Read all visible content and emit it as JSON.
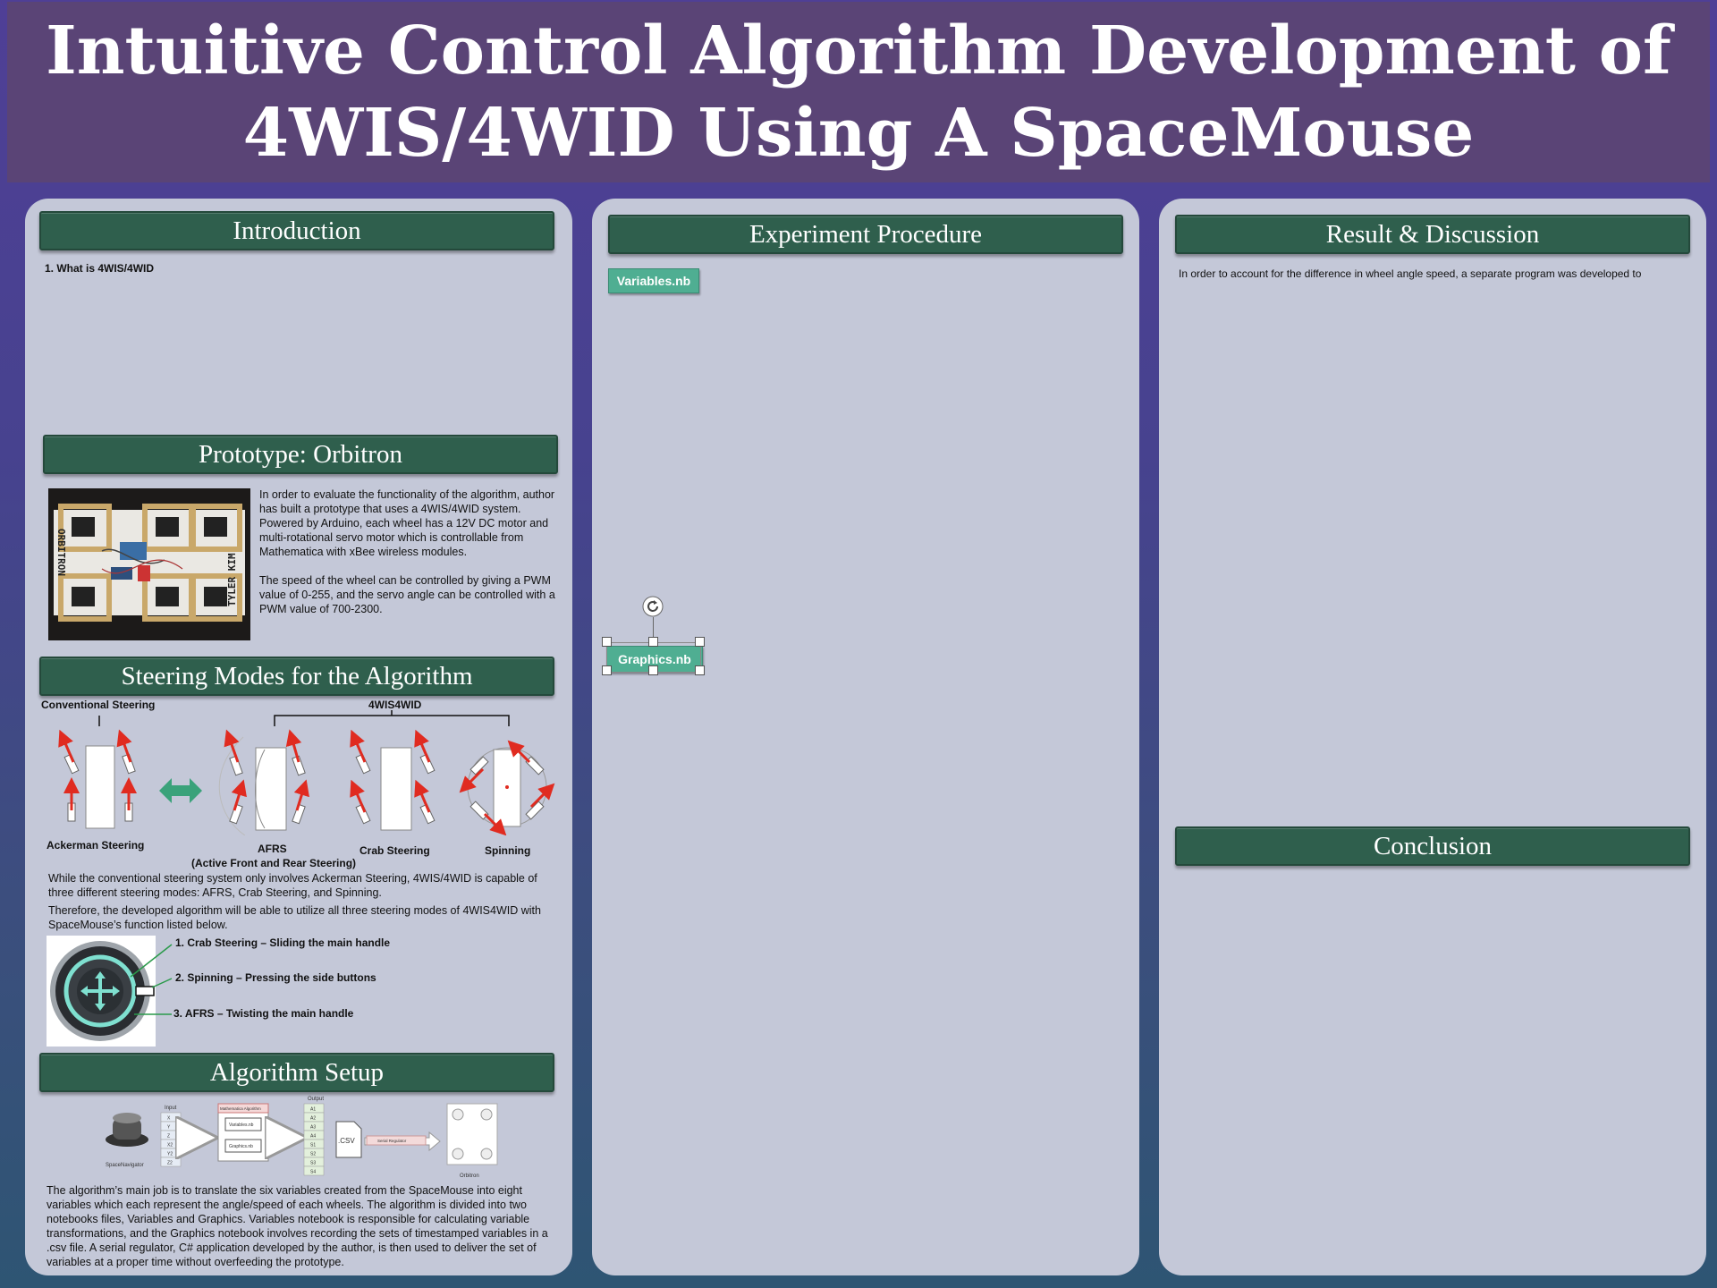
{
  "title": {
    "line1": "Intuitive Control Algorithm Development of",
    "line2": "4WIS/4WID Using A SpaceMouse"
  },
  "introduction": {
    "heading": "Introduction",
    "item": "1.   What is 4WIS/4WID"
  },
  "prototype": {
    "heading": "Prototype: Orbitron",
    "photo_text_left": "ORBITRON",
    "photo_text_right": "TYLER KIM",
    "paragraph1": "In order to evaluate the functionality of the algorithm, author has built a prototype that uses a 4WIS/4WID system. Powered by Arduino, each wheel has a 12V DC motor and multi-rotational servo motor which is controllable from Mathematica with xBee wireless modules.",
    "paragraph2": "The speed of the wheel can be controlled by giving a PWM value of 0-255, and the servo angle can be controlled with a PWM value of 700-2300."
  },
  "steering": {
    "heading": "Steering Modes for the Algorithm",
    "group_conventional": "Conventional Steering",
    "group_4wis": "4WIS4WID",
    "modes": [
      "Ackerman Steering",
      "AFRS",
      "Crab Steering",
      "Spinning"
    ],
    "afrs_sub": "(Active Front and Rear Steering)",
    "paragraph1": "While the conventional steering system only involves Ackerman Steering, 4WIS/4WID is capable of three different steering modes: AFRS, Crab Steering, and Spinning.",
    "paragraph2": "Therefore, the developed algorithm will be able to utilize all three steering modes of 4WIS4WID with SpaceMouse’s function listed below.",
    "features": [
      "1.   Crab Steering – Sliding the main handle",
      "2. Spinning – Pressing the side buttons",
      "3. AFRS – Twisting the main handle"
    ]
  },
  "algorithm": {
    "heading": "Algorithm Setup",
    "diagram": {
      "device": "SpaceNavigator",
      "input_header": "Input",
      "inputs": [
        "X",
        "Y",
        "Z",
        "X2",
        "Y2",
        "Z2"
      ],
      "math_header": "Mathematica Algorithm",
      "nb1": "Variables.nb",
      "nb2": "Graphics.nb",
      "output_header": "Output",
      "outputs": [
        "A1",
        "A2",
        "A3",
        "A4",
        "S1",
        "S2",
        "S3",
        "S4"
      ],
      "csv": ".CSV",
      "regulator": "Serial Regulator",
      "robot": "Orbitron"
    },
    "paragraph": "The algorithm’s main job is to translate the six variables created from the SpaceMouse into eight variables which each represent the angle/speed of each wheels. The algorithm is divided into two notebooks files, Variables and Graphics. Variables notebook is responsible for calculating variable transformations, and the Graphics notebook involves recording the sets of timestamped variables in a .csv file. A serial regulator, C# application developed by the author, is then used to deliver the set of variables at a proper time without overfeeding the prototype."
  },
  "experiment": {
    "heading": "Experiment Procedure",
    "button1": "Variables.nb",
    "button2": "Graphics.nb"
  },
  "results": {
    "heading": "Result & Discussion",
    "text": "In order to account for the difference in wheel angle speed, a separate program was developed to"
  },
  "conclusion": {
    "heading": "Conclusion"
  },
  "colors": {
    "title_bg": "#5a4476",
    "banner_bg": "#2f5f4d",
    "panel_bg": "#c4c8d8",
    "arrow_red": "#e02b20",
    "button_green": "#4fae92"
  }
}
